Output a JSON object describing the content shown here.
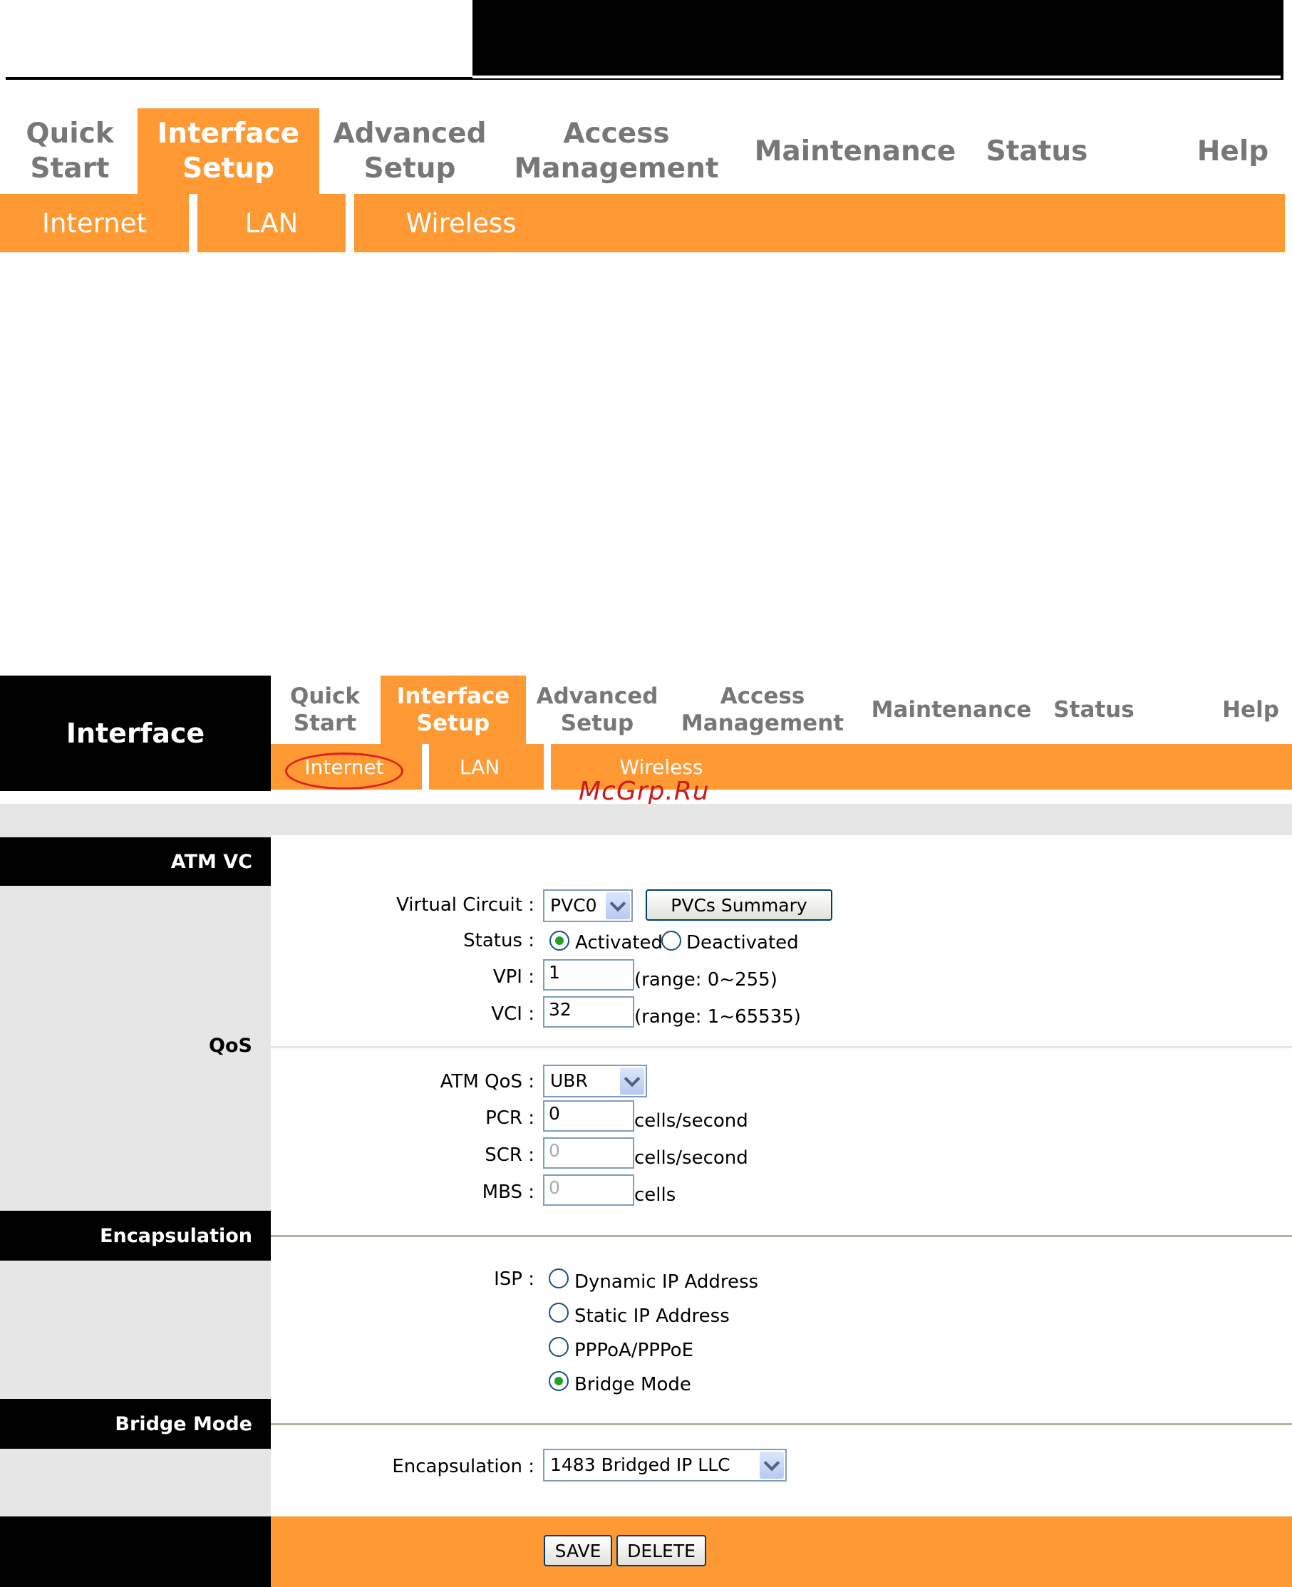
{
  "top": {
    "nav": [
      {
        "label": "Quick\nStart",
        "active": false
      },
      {
        "label": "Interface\nSetup",
        "active": true
      },
      {
        "label": "Advanced\nSetup",
        "active": false
      },
      {
        "label": "Access\nManagement",
        "active": false
      },
      {
        "label": "Maintenance",
        "active": false
      },
      {
        "label": "Status",
        "active": false
      },
      {
        "label": "Help",
        "active": false
      }
    ],
    "subnav": [
      "Internet",
      "LAN",
      "Wireless"
    ]
  },
  "second": {
    "logo": "Interface",
    "nav": [
      {
        "label": "Quick\nStart",
        "active": false
      },
      {
        "label": "Interface\nSetup",
        "active": true
      },
      {
        "label": "Advanced\nSetup",
        "active": false
      },
      {
        "label": "Access\nManagement",
        "active": false
      },
      {
        "label": "Maintenance",
        "active": false
      },
      {
        "label": "Status",
        "active": false
      },
      {
        "label": "Help",
        "active": false
      }
    ],
    "subnav": [
      "Internet",
      "LAN",
      "Wireless"
    ],
    "watermark": "McGrp.Ru",
    "sections": {
      "atm_vc": "ATM VC",
      "qos": "QoS",
      "encapsulation": "Encapsulation",
      "bridge_mode": "Bridge Mode"
    },
    "atm": {
      "virtual_circuit_label": "Virtual Circuit :",
      "virtual_circuit_value": "PVC0",
      "pvcs_summary_button": "PVCs Summary",
      "status_label": "Status :",
      "status_options": [
        "Activated",
        "Deactivated"
      ],
      "status_selected": "Activated",
      "vpi_label": "VPI :",
      "vpi_value": "1",
      "vpi_range": "(range: 0~255)",
      "vci_label": "VCI :",
      "vci_value": "32",
      "vci_range": "(range: 1~65535)"
    },
    "qos": {
      "atm_qos_label": "ATM QoS :",
      "atm_qos_value": "UBR",
      "pcr_label": "PCR :",
      "pcr_value": "0",
      "pcr_unit": "cells/second",
      "scr_label": "SCR :",
      "scr_value": "0",
      "scr_unit": "cells/second",
      "mbs_label": "MBS :",
      "mbs_value": "0",
      "mbs_unit": "cells"
    },
    "isp": {
      "label": "ISP :",
      "options": [
        "Dynamic IP Address",
        "Static IP Address",
        "PPPoA/PPPoE",
        "Bridge Mode"
      ],
      "selected": "Bridge Mode"
    },
    "bridge": {
      "encapsulation_label": "Encapsulation :",
      "encapsulation_value": "1483 Bridged IP LLC"
    },
    "buttons": {
      "save": "SAVE",
      "delete": "DELETE"
    },
    "colors": {
      "accent": "#ff9933",
      "section_header": "#000000",
      "sidebar": "#e6e6e6"
    }
  }
}
